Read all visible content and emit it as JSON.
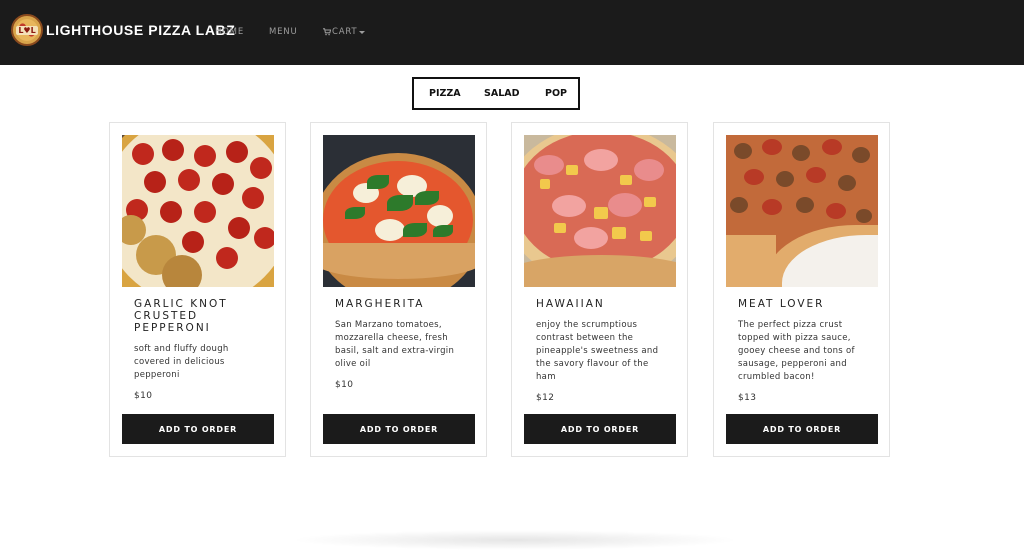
{
  "brand": {
    "logo_text": "L♥L",
    "name": "LIGHTHOUSE PIZZA LABZ"
  },
  "nav": {
    "home": "HOME",
    "menu": "MENU",
    "cart": "CART",
    "cart_icon": "shopping-cart-icon"
  },
  "tabs": [
    "PIZZA",
    "SALAD",
    "POP"
  ],
  "products": [
    {
      "name": "GARLIC KNOT CRUSTED PEPPERONI",
      "description": "soft and fluffy dough covered in delicious pepperoni",
      "price": "$10",
      "button": "ADD TO ORDER"
    },
    {
      "name": "MARGHERITA",
      "description": "San Marzano tomatoes, mozzarella cheese, fresh basil, salt and extra-virgin olive oil",
      "price": "$10",
      "button": "ADD TO ORDER"
    },
    {
      "name": "HAWAIIAN",
      "description": "enjoy the scrumptious contrast between the pineapple's sweetness and the savory flavour of the ham",
      "price": "$12",
      "button": "ADD TO ORDER"
    },
    {
      "name": "MEAT LOVER",
      "description": "The perfect pizza crust topped with pizza sauce, gooey cheese and tons of sausage, pepperoni and crumbled bacon!",
      "price": "$13",
      "button": "ADD TO ORDER"
    }
  ],
  "colors": {
    "navbar": "#1b1b1b",
    "button": "#1b1b1b",
    "nav_text": "#9d9d9d",
    "card_border": "#e3e3e3"
  }
}
